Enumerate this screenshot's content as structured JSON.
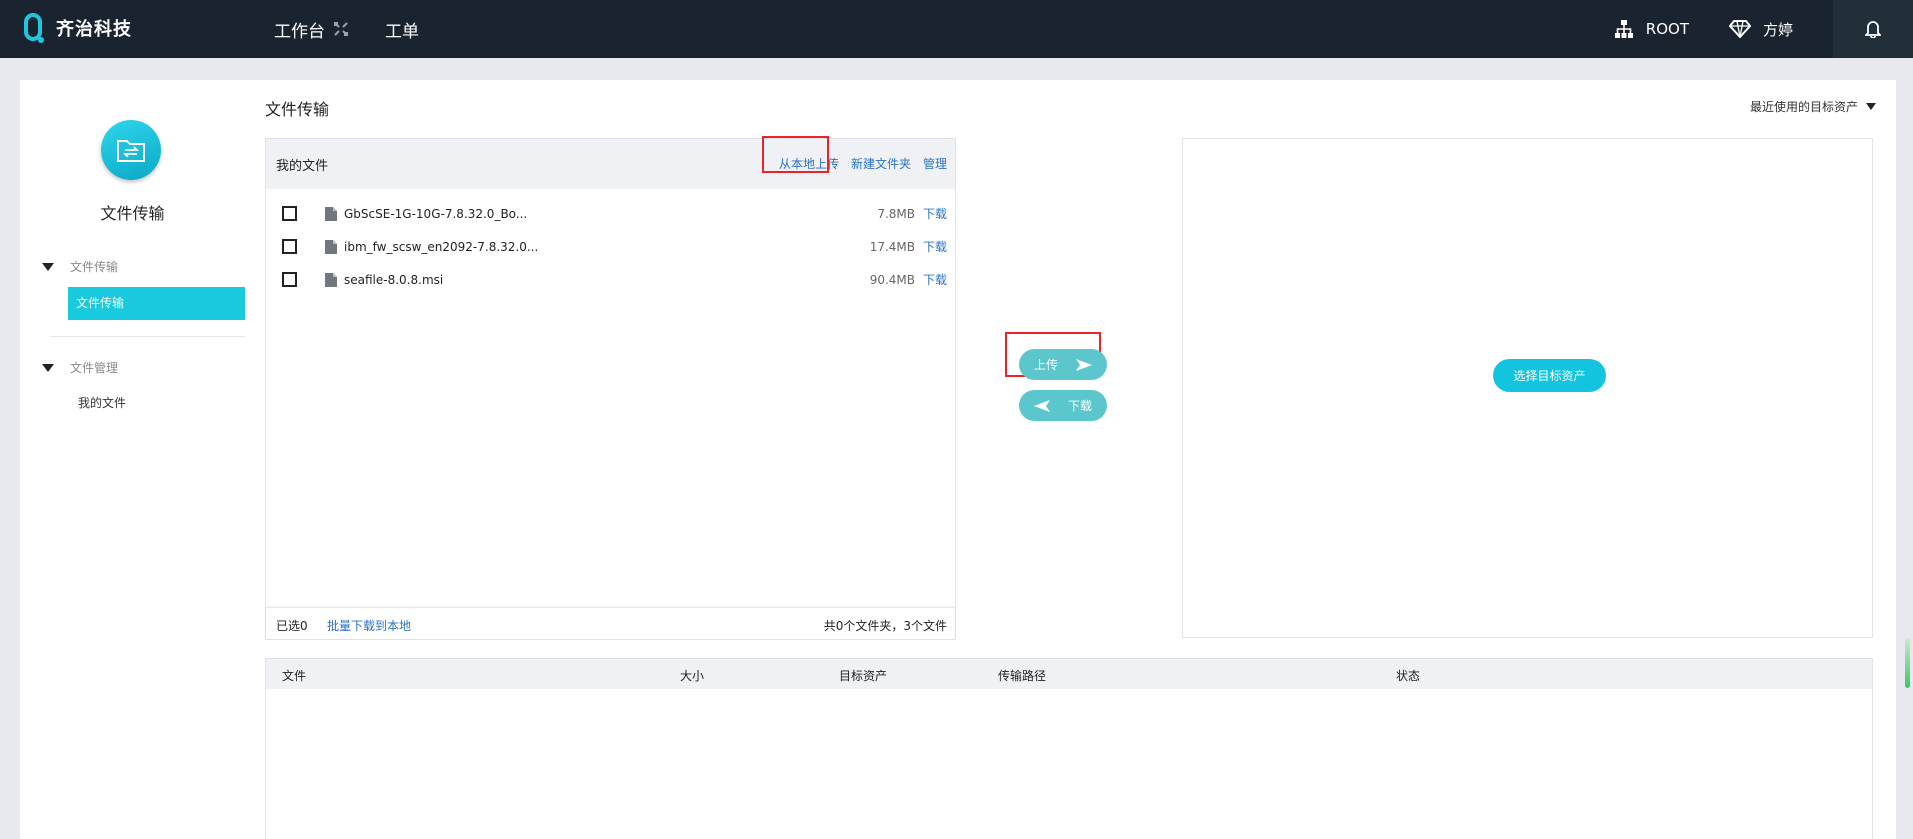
{
  "app": {
    "brand": "齐治科技",
    "nav": [
      {
        "label": "工作台"
      },
      {
        "label": "工单"
      }
    ],
    "org_label": "ROOT",
    "user_label": "方婷"
  },
  "sidebar": {
    "title": "文件传输",
    "groups": [
      {
        "label": "文件传输",
        "items": [
          {
            "label": "文件传输"
          }
        ]
      },
      {
        "label": "文件管理",
        "items": [
          {
            "label": "我的文件"
          }
        ]
      }
    ]
  },
  "main": {
    "title": "文件传输",
    "recent_targets": "最近使用的目标资产",
    "my_files": {
      "label": "我的文件",
      "actions": {
        "upload_local": "从本地上传",
        "new_folder": "新建文件夹",
        "manage": "管理"
      },
      "files": [
        {
          "name": "GbScSE-1G-10G-7.8.32.0_Bo...",
          "size": "7.8MB",
          "download": "下载"
        },
        {
          "name": "ibm_fw_scsw_en2092-7.8.32.0...",
          "size": "17.4MB",
          "download": "下载"
        },
        {
          "name": "seafile-8.0.8.msi",
          "size": "90.4MB",
          "download": "下载"
        }
      ],
      "footer": {
        "selected": "已选0",
        "batch_download": "批量下载到本地",
        "total": "共0个文件夹，3个文件"
      }
    },
    "transfer": {
      "upload": "上传",
      "download": "下载"
    },
    "target": {
      "choose": "选择目标资产"
    },
    "tasks": {
      "columns": [
        "文件",
        "大小",
        "目标资产",
        "传输路径",
        "状态"
      ]
    }
  },
  "colors": {
    "topbar": "#1a2430",
    "accent": "#19c9de",
    "link": "#2b73c6",
    "highlight": "#e8242b",
    "pill": "#5bc7cc"
  }
}
